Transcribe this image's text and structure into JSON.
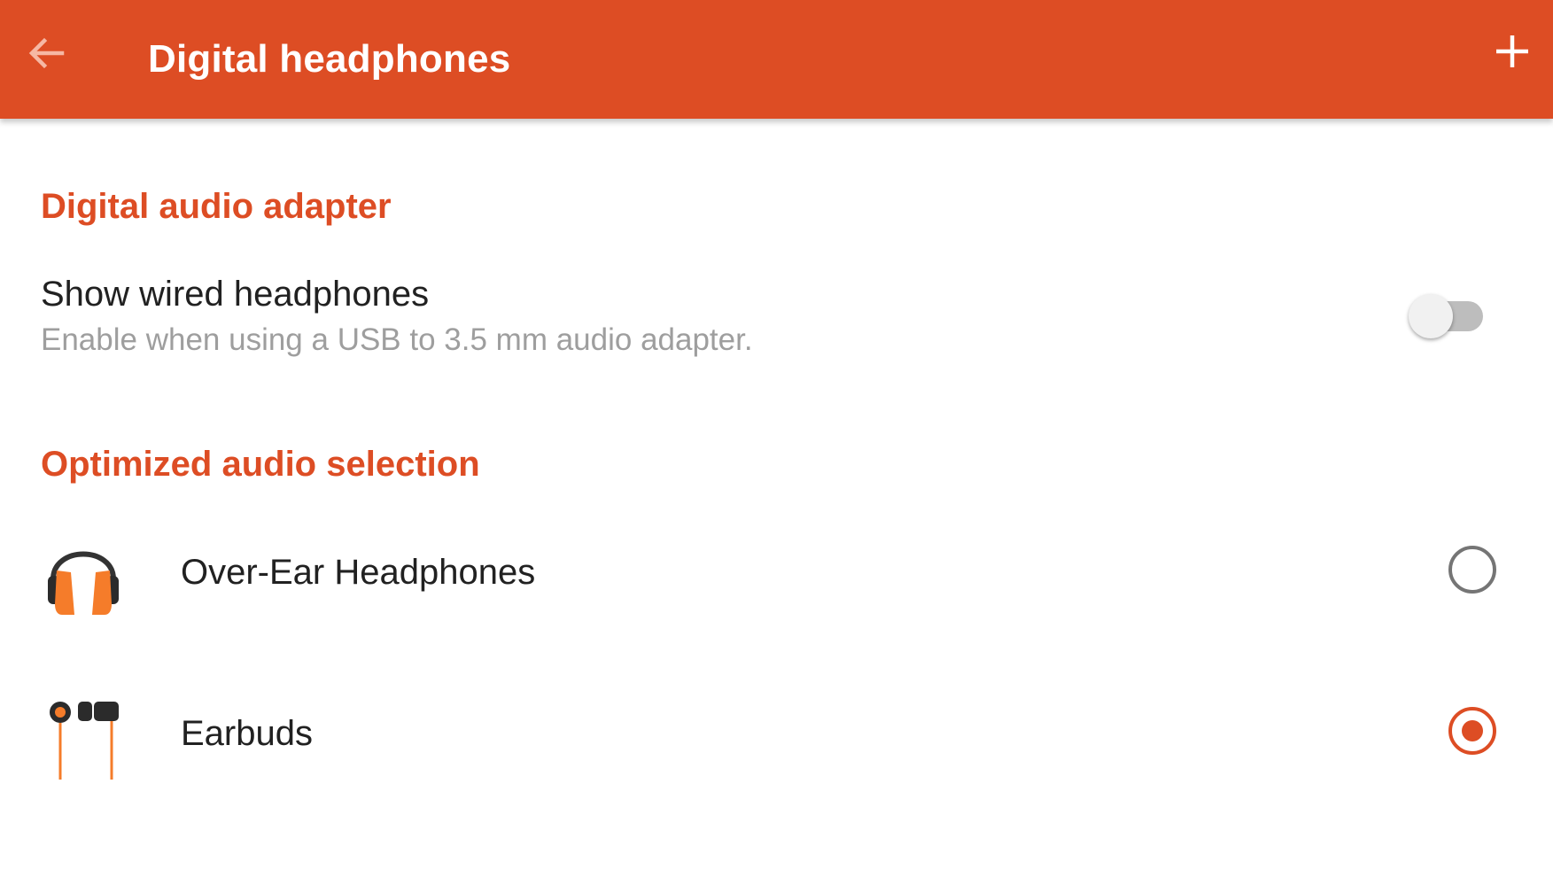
{
  "app_bar": {
    "title": "Digital headphones",
    "back_icon": "arrow-back-icon",
    "add_icon": "plus-icon",
    "background_color": "#DD4D24"
  },
  "sections": {
    "adapter": {
      "header": "Digital audio adapter",
      "wired_pref": {
        "title": "Show wired headphones",
        "summary": "Enable when using a USB to 3.5 mm audio adapter.",
        "enabled": false
      }
    },
    "selection": {
      "header": "Optimized audio selection",
      "options": [
        {
          "label": "Over-Ear Headphones",
          "icon": "over-ear-headphones-icon",
          "selected": false
        },
        {
          "label": "Earbuds",
          "icon": "earbuds-icon",
          "selected": true
        }
      ]
    }
  },
  "colors": {
    "accent": "#DD4D24",
    "primary_text": "#212121",
    "secondary_text": "#9E9E9E",
    "icon_orange": "#F57C2A"
  }
}
